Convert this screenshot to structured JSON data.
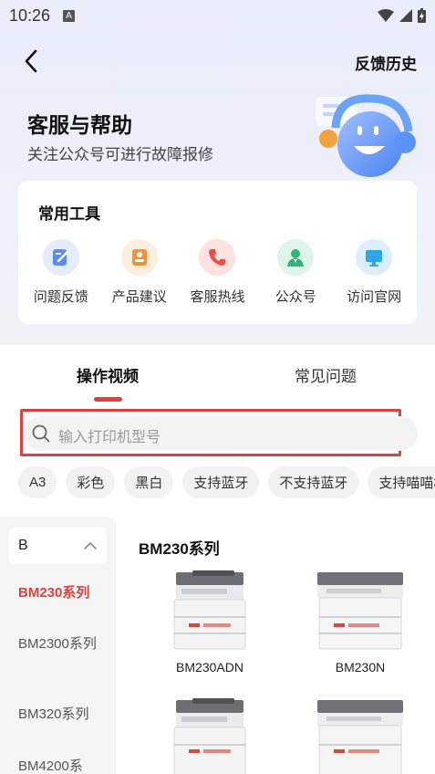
{
  "status": {
    "time": "10:26",
    "notif": "A"
  },
  "header": {
    "history_label": "反馈历史"
  },
  "hero": {
    "title": "客服与帮助",
    "subtitle": "关注公众号可进行故障报修"
  },
  "tools": {
    "title": "常用工具",
    "items": [
      {
        "label": "问题反馈",
        "icon": "edit-icon",
        "color": "#4a7de8"
      },
      {
        "label": "产品建议",
        "icon": "suggestion-icon",
        "color": "#f08a2c"
      },
      {
        "label": "客服热线",
        "icon": "phone-icon",
        "color": "#e8473f"
      },
      {
        "label": "公众号",
        "icon": "user-icon",
        "color": "#2bb673"
      },
      {
        "label": "访问官网",
        "icon": "monitor-icon",
        "color": "#2aa3e8"
      }
    ]
  },
  "tabs": [
    {
      "label": "操作视频",
      "active": true
    },
    {
      "label": "常见问题",
      "active": false
    }
  ],
  "search": {
    "placeholder": "输入打印机型号",
    "value": ""
  },
  "chips": [
    "A3",
    "彩色",
    "黑白",
    "支持蓝牙",
    "不支持蓝牙",
    "支持喵喵相"
  ],
  "sidebar": {
    "selected": "B",
    "items": [
      {
        "label": "BM230系列",
        "active": true
      },
      {
        "label": "BM2300系列",
        "active": false
      },
      {
        "label": "BM320系列",
        "active": false
      },
      {
        "label": "BM4200系",
        "active": false
      }
    ]
  },
  "content": {
    "heading": "BM230系列",
    "products": [
      {
        "name": "BM230ADN"
      },
      {
        "name": "BM230N"
      },
      {
        "name": ""
      },
      {
        "name": ""
      }
    ]
  },
  "colors": {
    "accent": "#e0403c",
    "hero_bg": "#eceefa"
  }
}
